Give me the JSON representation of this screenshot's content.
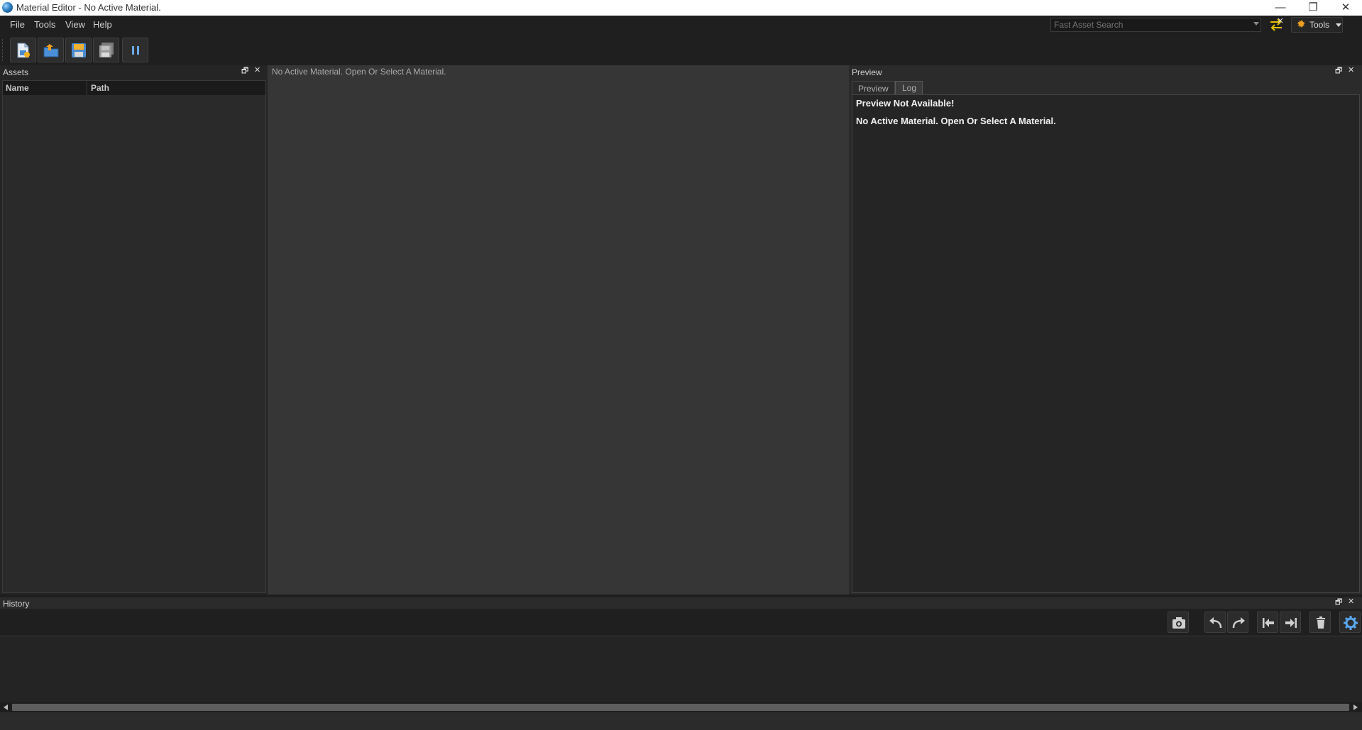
{
  "window": {
    "title": "Material Editor - No Active Material.",
    "minimize_glyph": "—",
    "restore_glyph": "❐",
    "close_glyph": "✕"
  },
  "menu": {
    "items": [
      "File",
      "Tools",
      "View",
      "Help"
    ]
  },
  "search": {
    "placeholder": "Fast Asset Search"
  },
  "tools_button": {
    "label": "Tools",
    "icon": "gear-icon"
  },
  "toolbar": {
    "buttons": [
      {
        "name": "new-material-button",
        "icon": "new-document-icon"
      },
      {
        "name": "open-material-button",
        "icon": "open-folder-icon"
      },
      {
        "name": "save-button",
        "icon": "save-icon"
      },
      {
        "name": "save-all-button",
        "icon": "save-all-icon"
      },
      {
        "name": "pause-button",
        "icon": "pause-icon"
      }
    ]
  },
  "assets": {
    "title": "Assets",
    "columns": [
      "Name",
      "Path"
    ],
    "rows": []
  },
  "center": {
    "message": "No Active Material. Open Or Select A Material."
  },
  "preview": {
    "title": "Preview",
    "tabs": [
      "Preview",
      "Log"
    ],
    "active_tab": "Log",
    "line1": "Preview Not Available!",
    "line2": "No Active Material. Open Or Select A Material."
  },
  "history": {
    "title": "History",
    "buttons": [
      "camera-icon",
      "undo-icon",
      "redo-icon",
      "jump-first-icon",
      "jump-last-icon",
      "trash-icon",
      "settings-gear-icon"
    ]
  },
  "colors": {
    "accent_gear": "#f0a020",
    "panel_bg": "#2b2b2b",
    "center_bg": "#363636",
    "menubar_bg": "#1f1f1f"
  },
  "dock_glyphs": {
    "float": "🗗",
    "close": "✕"
  }
}
